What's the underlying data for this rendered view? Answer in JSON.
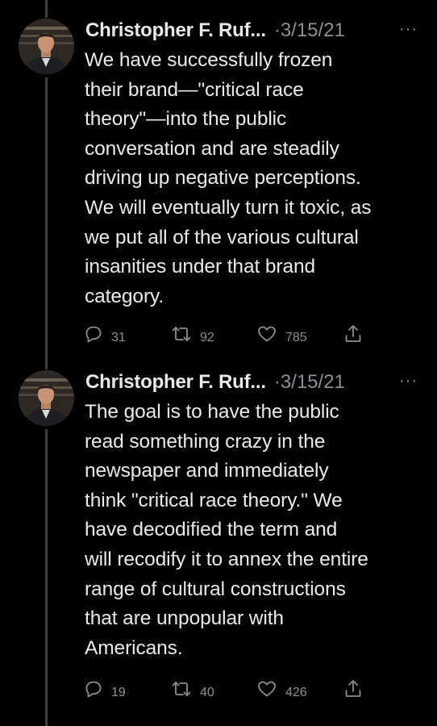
{
  "colors": {
    "background": "#000000",
    "text": "#e7e9ea",
    "secondary": "#8b8f94",
    "thread_line": "#3a3d41"
  },
  "tweets": [
    {
      "author": "Christopher F. Ruf...",
      "separator": "·",
      "date": "3/15/21",
      "more_icon": "more-dots-icon",
      "text": "We have successfully frozen\ntheir brand—\"critical race\ntheory\"—into the public\nconversation and are steadily\ndriving up negative perceptions.\nWe will eventually turn it toxic, as\nwe put all of the various cultural\ninsanities under that brand\ncategory.",
      "replies": "31",
      "retweets": "92",
      "likes": "785"
    },
    {
      "author": "Christopher F. Ruf...",
      "separator": "·",
      "date": "3/15/21",
      "more_icon": "more-dots-icon",
      "text": "The goal is to have the public\nread something crazy in the\nnewspaper and immediately\nthink \"critical race theory.\" We\nhave decodified the term and\nwill recodify it to annex the entire\nrange of cultural constructions\nthat are unpopular with\nAmericans.",
      "replies": "19",
      "retweets": "40",
      "likes": "426"
    }
  ],
  "icons": {
    "more": "···",
    "reply": "reply-icon",
    "retweet": "retweet-icon",
    "like": "heart-icon",
    "share": "share-icon"
  }
}
